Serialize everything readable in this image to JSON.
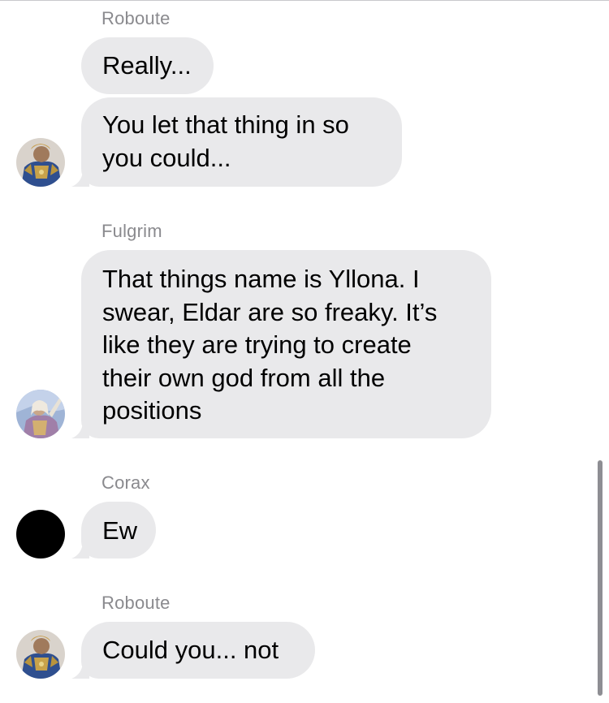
{
  "messages": [
    {
      "sender": "Roboute",
      "texts": [
        "Really...",
        "You let that thing in so\nyou could..."
      ],
      "avatar_icon": "roboute-avatar-icon"
    },
    {
      "sender": "Fulgrim",
      "texts": [
        "That things name is Yllona. I\nswear, Eldar are so freaky. It’s\nlike they are trying to create\ntheir own god from all the\npositions"
      ],
      "avatar_icon": "fulgrim-avatar-icon"
    },
    {
      "sender": "Corax",
      "texts": [
        "Ew"
      ],
      "avatar_icon": "corax-avatar-icon"
    },
    {
      "sender": "Roboute",
      "texts": [
        "Could you... not"
      ],
      "avatar_icon": "roboute-avatar-icon"
    }
  ],
  "colors": {
    "bubble": "#e9e9eb",
    "sender": "#8a8a8e",
    "background": "#ffffff"
  }
}
